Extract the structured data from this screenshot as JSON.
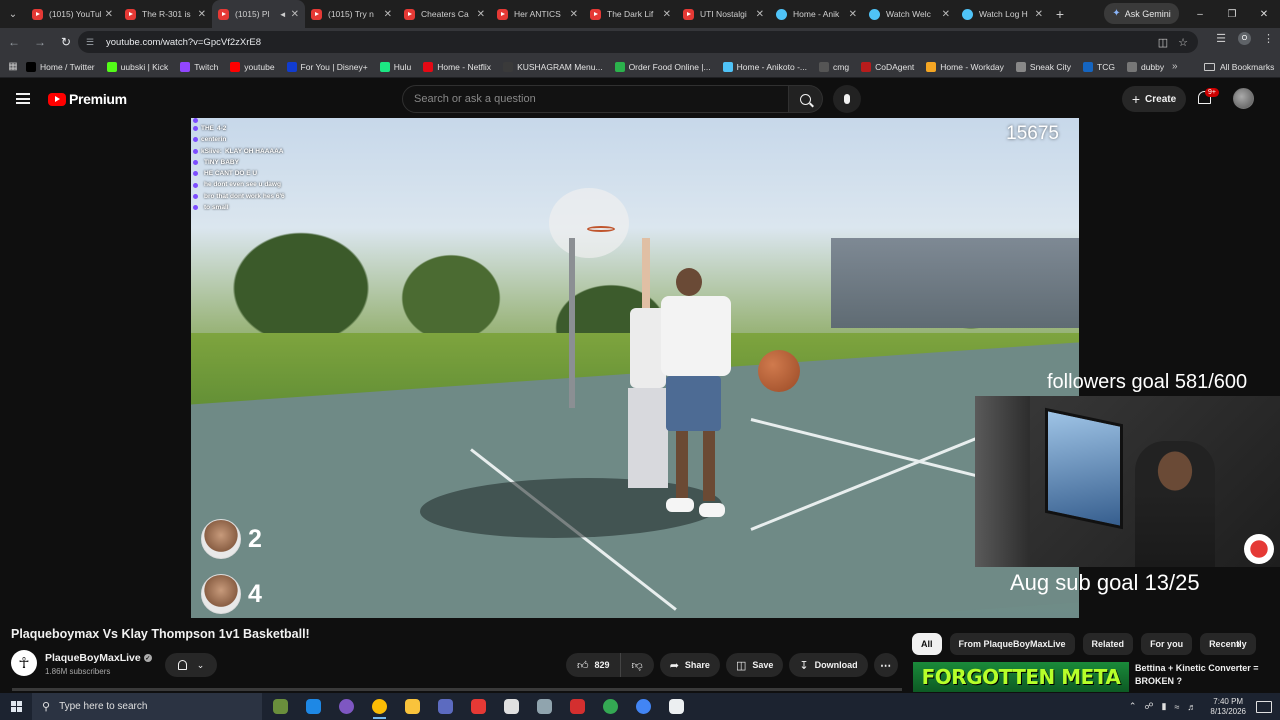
{
  "browser": {
    "tabs": [
      {
        "label": "(1015) YouTube",
        "favicon": "youtube-icon",
        "active": false
      },
      {
        "label": "The R-301 is",
        "favicon": "youtube-icon",
        "active": false
      },
      {
        "label": "(1015) Pl",
        "favicon": "youtube-icon",
        "active": true,
        "audio": true
      },
      {
        "label": "(1015) Try n",
        "favicon": "youtube-icon",
        "active": false
      },
      {
        "label": "Cheaters Ca",
        "favicon": "youtube-icon",
        "active": false
      },
      {
        "label": "Her ANTICS",
        "favicon": "youtube-icon",
        "active": false
      },
      {
        "label": "The Dark Lif",
        "favicon": "youtube-icon",
        "active": false
      },
      {
        "label": "UTI Nostalgi",
        "favicon": "youtube-icon",
        "active": false
      },
      {
        "label": "Home - Anik",
        "favicon": "globe-icon",
        "active": false
      },
      {
        "label": "Watch Welc",
        "favicon": "globe-icon",
        "active": false
      },
      {
        "label": "Watch Log H",
        "favicon": "globe-icon",
        "active": false
      }
    ],
    "new_tab": "+",
    "gemini_label": "Ask Gemini",
    "url": "youtube.com/watch?v=GpcVf2zXrE8",
    "bookmarks": [
      {
        "label": "Home / Twitter",
        "icon": "x-icon",
        "color": "#000000"
      },
      {
        "label": "uubski | Kick",
        "icon": "kick-icon",
        "color": "#53fc18"
      },
      {
        "label": "Twitch",
        "icon": "twitch-icon",
        "color": "#9146ff"
      },
      {
        "label": "youtube",
        "icon": "youtube-icon",
        "color": "#ff0000"
      },
      {
        "label": "For You | Disney+",
        "icon": "disney-icon",
        "color": "#113ccf"
      },
      {
        "label": "Hulu",
        "icon": "hulu-icon",
        "color": "#1ce783"
      },
      {
        "label": "Home - Netflix",
        "icon": "netflix-icon",
        "color": "#e50914"
      },
      {
        "label": "KUSHAGRAM Menu...",
        "icon": "leaf-icon",
        "color": "#3a3a3a"
      },
      {
        "label": "Order Food Online |...",
        "icon": "food-icon",
        "color": "#2bb24c"
      },
      {
        "label": "Home - Anikoto -...",
        "icon": "anikoto-icon",
        "color": "#4fc3f7"
      },
      {
        "label": "cmg",
        "icon": "cmg-icon",
        "color": "#555555"
      },
      {
        "label": "CoDAgent",
        "icon": "cod-icon",
        "color": "#b71c1c"
      },
      {
        "label": "Home - Workday",
        "icon": "workday-icon",
        "color": "#f5a623"
      },
      {
        "label": "Sneak City",
        "icon": "sneak-icon",
        "color": "#888888"
      },
      {
        "label": "TCG",
        "icon": "tcg-icon",
        "color": "#1565c0"
      },
      {
        "label": "dubby",
        "icon": "dubby-icon",
        "color": "#777777"
      }
    ],
    "all_bookmarks": "All Bookmarks",
    "profile_initial": "O"
  },
  "youtube": {
    "logo_text": "Premium",
    "search_placeholder": "Search or ask a question",
    "create_label": "Create",
    "notif_badge": "9+"
  },
  "video": {
    "viewer_counter": "15675",
    "chat": [
      {
        "name": "",
        "msg": ""
      },
      {
        "name": "THE",
        "msg": "4-2"
      },
      {
        "name": "centerin",
        "msg": ""
      },
      {
        "name": "kSiive:",
        "msg": "KLAY OH HAAAAA"
      },
      {
        "name": "",
        "msg": "TINY BABY"
      },
      {
        "name": "",
        "msg": "HE CANT DO E U"
      },
      {
        "name": "",
        "msg": "he dont even see u dawg"
      },
      {
        "name": "",
        "msg": "bro that dont work hes 6'6"
      },
      {
        "name": "",
        "msg": "to small"
      }
    ],
    "scores": [
      {
        "value": "2"
      },
      {
        "value": "4"
      }
    ],
    "followers_goal": "followers goal 581/600",
    "sub_goal": "Aug sub goal 13/25"
  },
  "details": {
    "title": "Plaqueboymax Vs Klay Thompson 1v1 Basketball!",
    "channel": "PlaqueBoyMaxLive",
    "subscribers": "1.86M subscribers",
    "likes": "829",
    "share": "Share",
    "save": "Save",
    "download": "Download"
  },
  "sidebar": {
    "chips": [
      "All",
      "From PlaqueBoyMaxLive",
      "Related",
      "For you",
      "Recently"
    ],
    "rec_thumb_text": "FORGOTTEN META",
    "rec_title": "Bettina + Kinetic Converter = BROKEN ?"
  },
  "taskbar": {
    "search_placeholder": "Type here to search",
    "time": "7:40 PM",
    "date": "8/13/2026",
    "apps": [
      {
        "icon": "grinch-icon",
        "color": "#6a8f3c"
      },
      {
        "icon": "app-blue-icon",
        "color": "#1e88e5"
      },
      {
        "icon": "chrome-profile-icon",
        "color": "#7e57c2"
      },
      {
        "icon": "chrome-icon",
        "color": "#fbbc05"
      },
      {
        "icon": "file-explorer-icon",
        "color": "#f9c33c"
      },
      {
        "icon": "game-controller-icon",
        "color": "#5c6bc0"
      },
      {
        "icon": "media-player-icon",
        "color": "#e53935"
      },
      {
        "icon": "github-icon",
        "color": "#e0e0e0"
      },
      {
        "icon": "app-circle-icon",
        "color": "#90a4ae"
      },
      {
        "icon": "acrobat-icon",
        "color": "#d32f2f"
      },
      {
        "icon": "chrome-icon-2",
        "color": "#34a853"
      },
      {
        "icon": "chrome-icon-3",
        "color": "#4285f4"
      },
      {
        "icon": "clock-app-icon",
        "color": "#eceff1"
      }
    ]
  }
}
